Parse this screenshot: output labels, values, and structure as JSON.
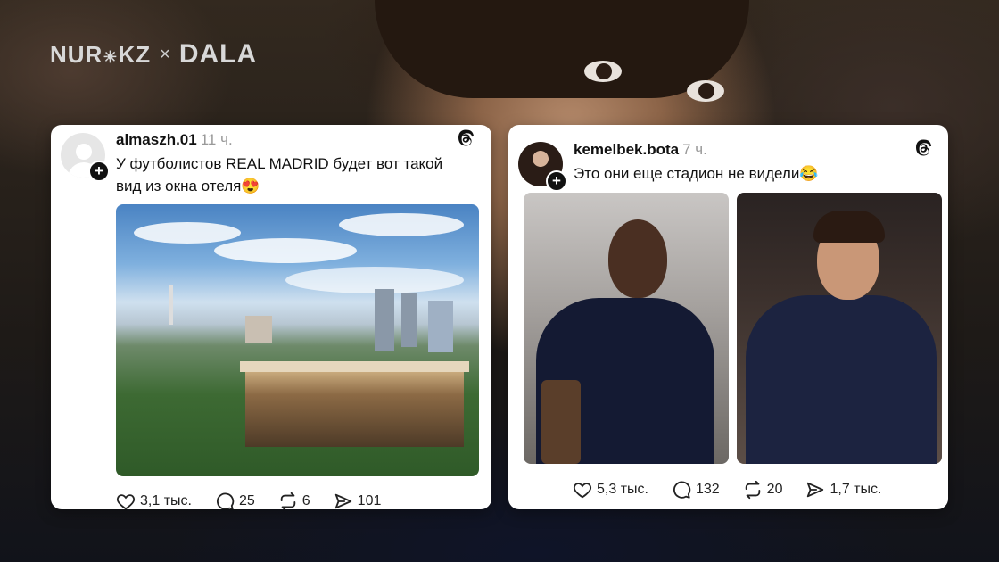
{
  "branding": {
    "nur_logo": "NUR",
    "nur_logo_suffix": "KZ",
    "separator": "×",
    "dala_logo": "DALA"
  },
  "posts": [
    {
      "username": "almaszh.01",
      "time": "11 ч.",
      "text_line1": "У футболистов REAL MADRID будет вот такой",
      "text_line2": "вид из окна отеля😍",
      "likes": "3,1 тыс.",
      "comments": "25",
      "reposts": "6",
      "shares": "101"
    },
    {
      "username": "kemelbek.bota",
      "time": "7 ч.",
      "text_line1": "Это они еще стадион не видели😂",
      "likes": "5,3 тыс.",
      "comments": "132",
      "reposts": "20",
      "shares": "1,7 тыс."
    }
  ],
  "icons": {
    "threads": "threads-logo-icon",
    "like": "heart-icon",
    "comment": "comment-bubble-icon",
    "repost": "repost-icon",
    "share": "send-icon"
  },
  "colors": {
    "card_bg": "#ffffff",
    "time_gray": "#999999",
    "text": "#111111"
  }
}
